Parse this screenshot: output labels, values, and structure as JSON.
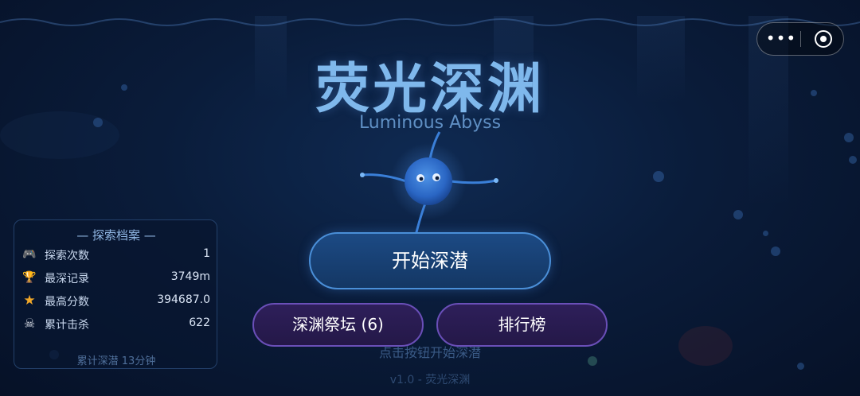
{
  "game": {
    "title": "荧光深渊",
    "subtitle": "Luminous Abyss"
  },
  "capsule": {
    "more_label": "•••",
    "more_icon": "more-dots-icon",
    "close_icon": "record-circle-icon"
  },
  "menu": {
    "start_label": "开始深潜",
    "altar_label": "深渊祭坛 (6)",
    "rank_label": "排行榜"
  },
  "hint": "点击按钮开始深潜",
  "version": "v1.0 - 荧光深渊",
  "stats": {
    "title": "— 探索档案 —",
    "rows": [
      {
        "icon": "gamepad-icon",
        "glyph": "🎮",
        "label": "探索次数",
        "value": "1"
      },
      {
        "icon": "trophy-icon",
        "glyph": "🏆",
        "label": "最深记录",
        "value": "3749m"
      },
      {
        "icon": "star-icon",
        "glyph": "★",
        "label": "最高分数",
        "value": "394687.0"
      },
      {
        "icon": "skull-icon",
        "glyph": "☠",
        "label": "累计击杀",
        "value": "622"
      }
    ],
    "footer": "累计深潜 13分钟"
  },
  "colors": {
    "background": "#0a1c3a",
    "title": "#7fb8ec",
    "primary_button_border": "#4a8fd8",
    "secondary_button_border": "#6a4fb8"
  }
}
